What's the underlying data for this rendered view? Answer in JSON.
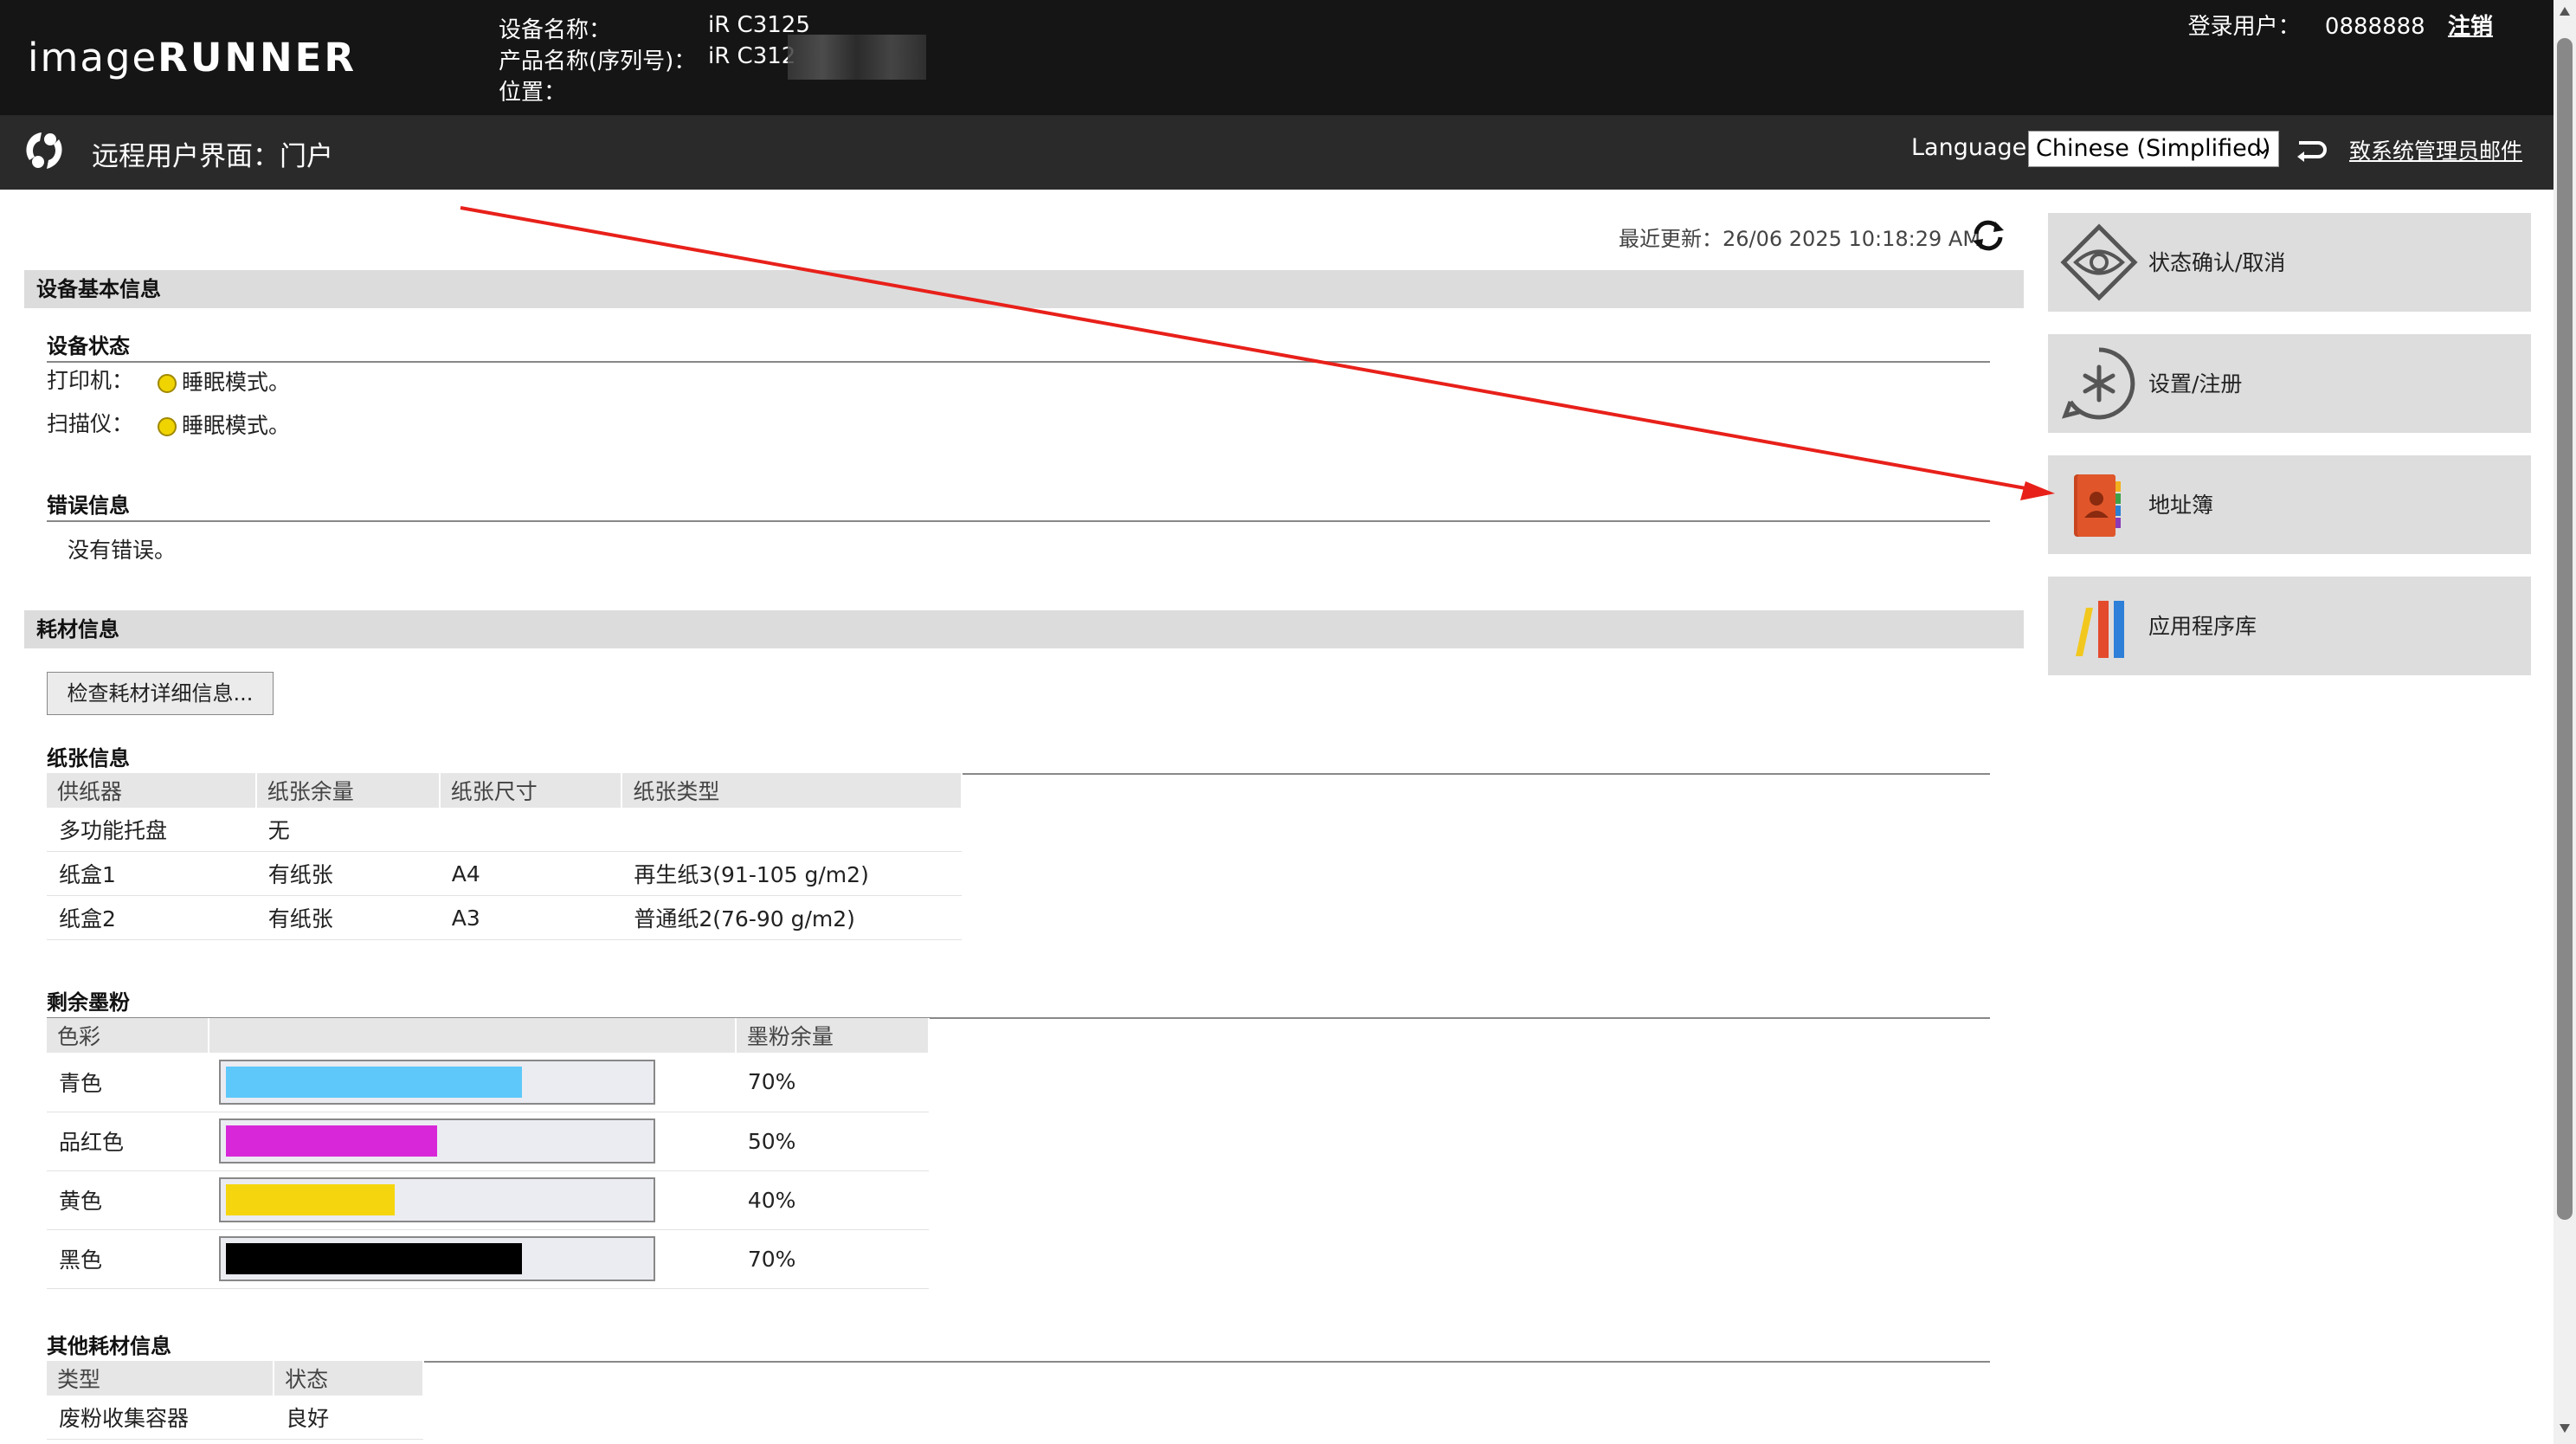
{
  "header": {
    "logo_part1": "image",
    "logo_part2": "RUNNER",
    "device_name_label": "设备名称：",
    "device_name_value": "iR C3125",
    "product_name_label": "产品名称(序列号)：",
    "product_name_value": "iR C312",
    "location_label": "位置：",
    "login_label": "登录用户：",
    "login_user": "0888888",
    "logout_label": "注销"
  },
  "subheader": {
    "portal_title": "远程用户界面：门户",
    "language_label": "Language:",
    "language_selected": "Chinese (Simplified)",
    "admin_mail_label": "致系统管理员邮件"
  },
  "status": {
    "last_update": "最近更新：26/06 2025 10:18:29 AM"
  },
  "device_basic_info": {
    "section_title": "设备基本信息",
    "device_status_title": "设备状态",
    "printer_label": "打印机：",
    "printer_status": "睡眠模式。",
    "scanner_label": "扫描仪：",
    "scanner_status": "睡眠模式。",
    "error_title": "错误信息",
    "error_text": "没有错误。"
  },
  "consumables": {
    "section_title": "耗材信息",
    "check_button": "检查耗材详细信息...",
    "paper_title": "纸张信息",
    "paper_headers": [
      "供纸器",
      "纸张余量",
      "纸张尺寸",
      "纸张类型"
    ],
    "paper_rows": [
      [
        "多功能托盘",
        "无",
        "",
        ""
      ],
      [
        "纸盒1",
        "有纸张",
        "A4",
        "再生纸3(91-105 g/m2)"
      ],
      [
        "纸盒2",
        "有纸张",
        "A3",
        "普通纸2(76-90 g/m2)"
      ]
    ],
    "toner_title": "剩余墨粉",
    "toner_headers": [
      "色彩",
      "",
      "墨粉余量"
    ],
    "toner_rows": [
      {
        "color": "青色",
        "level": 0.7,
        "text": "70%",
        "hex": "#5ec8fa"
      },
      {
        "color": "品红色",
        "level": 0.5,
        "text": "50%",
        "hex": "#d827d8"
      },
      {
        "color": "黄色",
        "level": 0.4,
        "text": "40%",
        "hex": "#f5d60e"
      },
      {
        "color": "黑色",
        "level": 0.7,
        "text": "70%",
        "hex": "#000000"
      }
    ],
    "other_title": "其他耗材信息",
    "other_headers": [
      "类型",
      "状态"
    ],
    "other_rows": [
      [
        "废粉收集容器",
        "良好"
      ]
    ]
  },
  "side_panel": {
    "status_label": "状态确认/取消",
    "settings_label": "设置/注册",
    "address_book_label": "地址簿",
    "app_library_label": "应用程序库"
  },
  "colors": {
    "header_bg": "#151515",
    "subheader_bg": "#2a2a2a",
    "annotation_arrow": "#e8201a"
  }
}
